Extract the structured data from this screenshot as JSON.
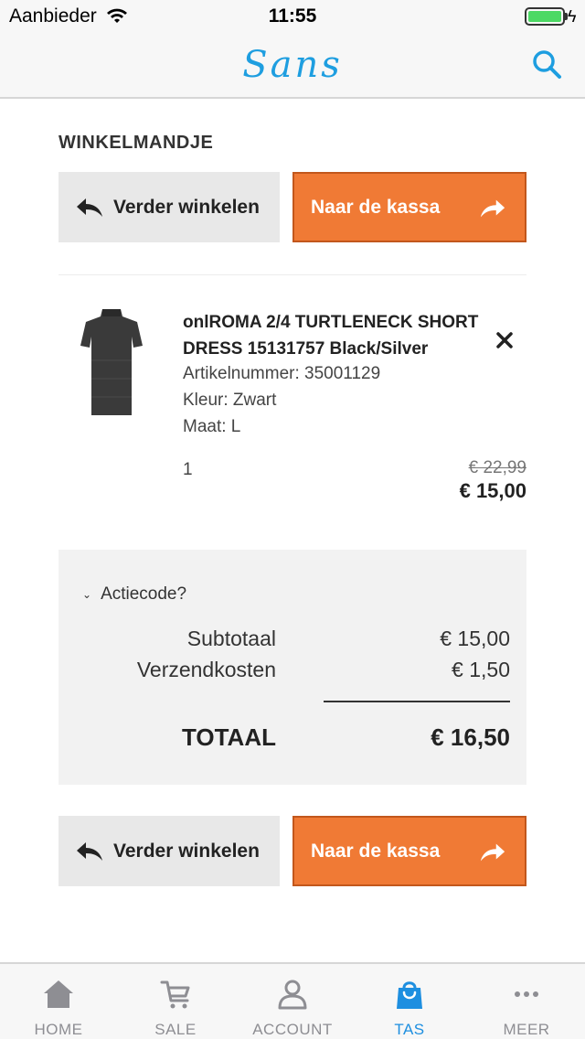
{
  "status_bar": {
    "carrier": "Aanbieder",
    "time": "11:55"
  },
  "header": {
    "logo": "Sans",
    "search_icon": "search-icon"
  },
  "page": {
    "title": "WINKELMANDJE"
  },
  "actions": {
    "continue_label": "Verder winkelen",
    "checkout_label": "Naar de kassa"
  },
  "cart_item": {
    "name": "onlROMA 2/4 TURTLENECK SHORT DRESS 15131757 Black/Silver",
    "article_number": "Artikelnummer: 35001129",
    "color": "Kleur: Zwart",
    "size": "Maat: L",
    "quantity": "1",
    "old_price": "€ 22,99",
    "price": "€ 15,00"
  },
  "summary": {
    "promo_label": "Actiecode?",
    "subtotal_label": "Subtotaal",
    "subtotal_value": "€ 15,00",
    "shipping_label": "Verzendkosten",
    "shipping_value": "€ 1,50",
    "total_label": "TOTAAL",
    "total_value": "€ 16,50"
  },
  "tabs": [
    {
      "label": "HOME",
      "icon": "home-icon",
      "active": false
    },
    {
      "label": "SALE",
      "icon": "cart-icon",
      "active": false
    },
    {
      "label": "ACCOUNT",
      "icon": "user-icon",
      "active": false
    },
    {
      "label": "TAS",
      "icon": "bag-icon",
      "active": true
    },
    {
      "label": "MEER",
      "icon": "more-icon",
      "active": false
    }
  ],
  "colors": {
    "accent": "#1e9ee0",
    "checkout_button": "#f07a35",
    "active_tab": "#1e8fe0"
  }
}
